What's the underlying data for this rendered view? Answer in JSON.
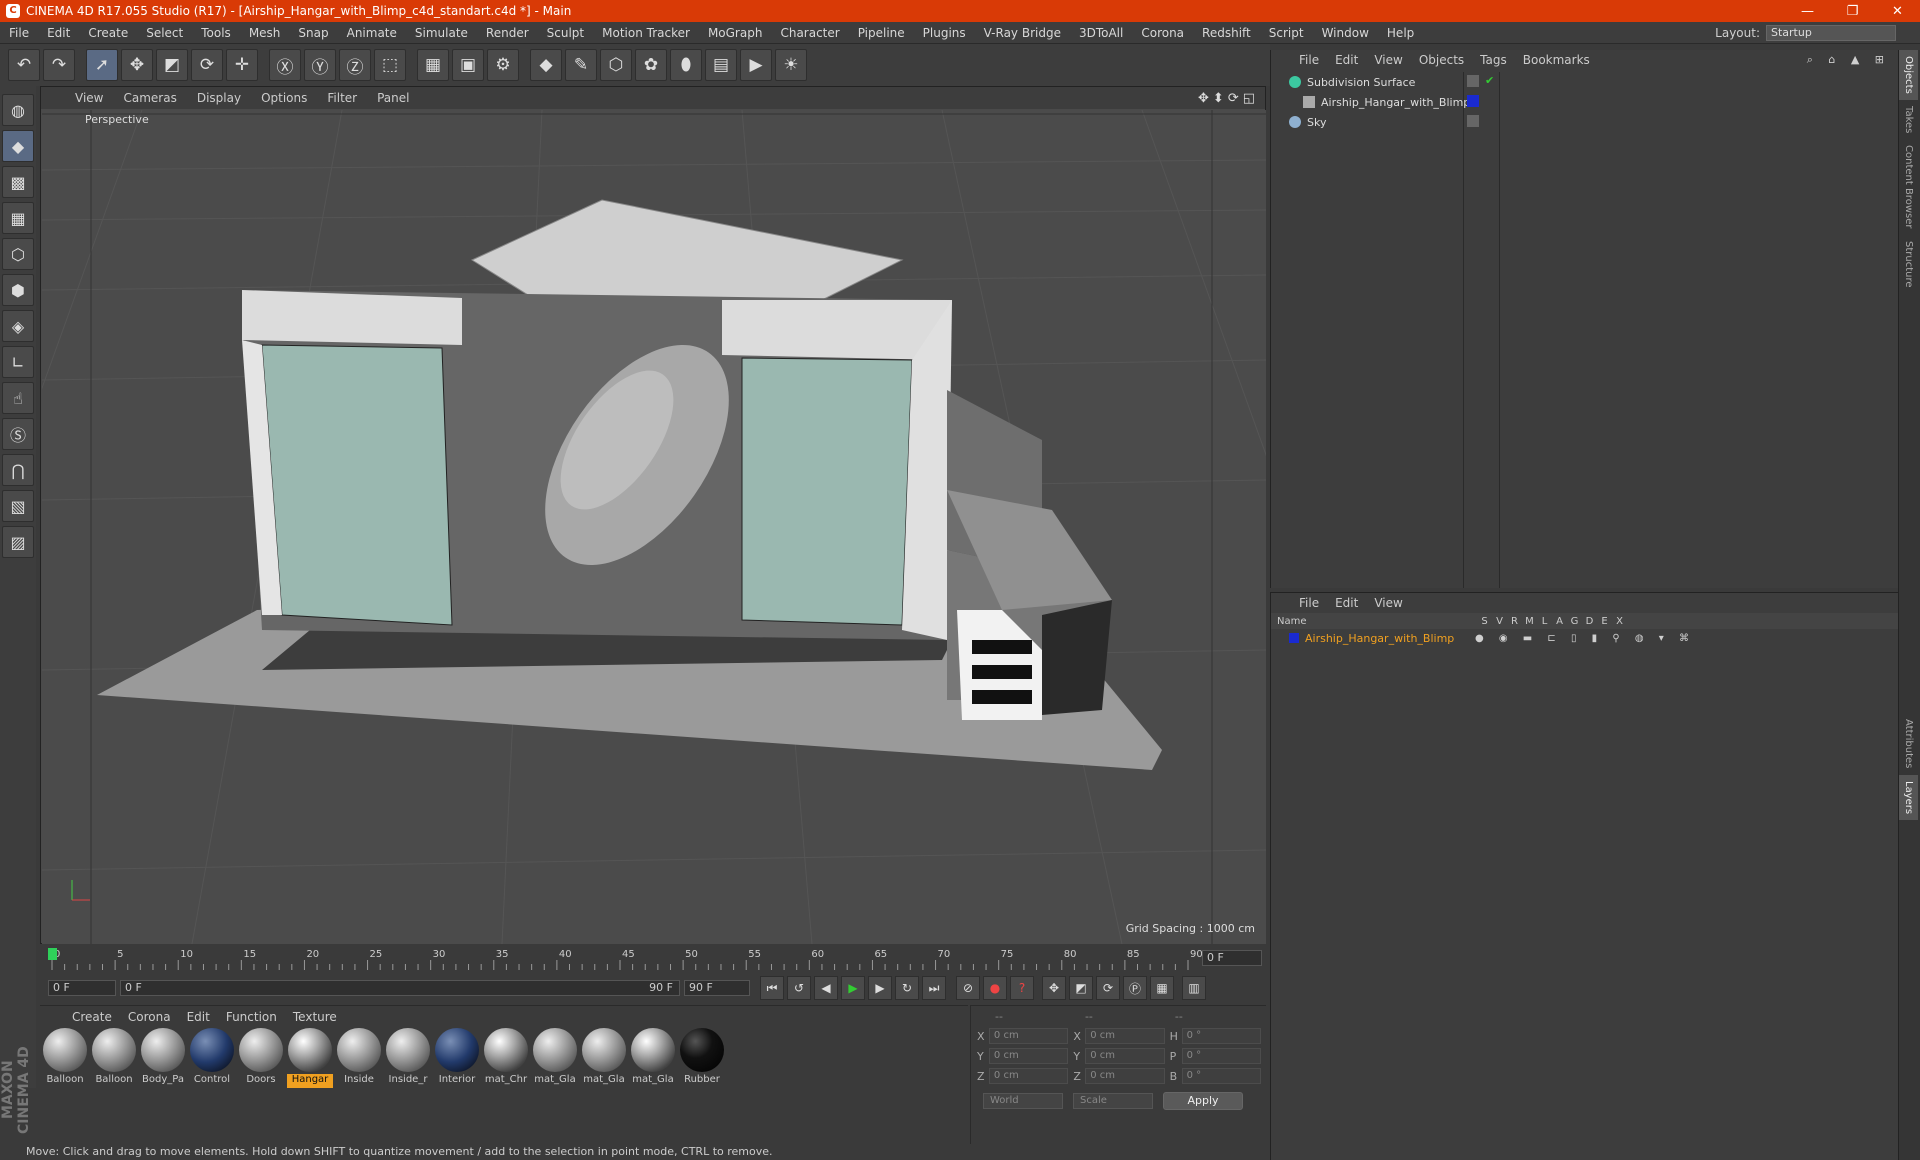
{
  "window": {
    "title": "CINEMA 4D R17.055 Studio (R17) - [Airship_Hangar_with_Blimp_c4d_standart.c4d *] - Main",
    "minimize": "—",
    "restore": "❐",
    "close": "✕"
  },
  "menubar": {
    "items": [
      "File",
      "Edit",
      "Create",
      "Select",
      "Tools",
      "Mesh",
      "Snap",
      "Animate",
      "Simulate",
      "Render",
      "Sculpt",
      "Motion Tracker",
      "MoGraph",
      "Character",
      "Pipeline",
      "Plugins",
      "V-Ray Bridge",
      "3DToAll",
      "Corona",
      "Redshift",
      "Script",
      "Window",
      "Help"
    ],
    "layout_label": "Layout:",
    "layout_value": "Startup"
  },
  "viewport": {
    "menu": [
      "View",
      "Cameras",
      "Display",
      "Options",
      "Filter",
      "Panel"
    ],
    "nav_icons": "✥⬍⟳◱",
    "label": "Perspective",
    "grid_spacing": "Grid Spacing : 1000 cm"
  },
  "timeline": {
    "ticks": [
      "0",
      "5",
      "10",
      "15",
      "20",
      "25",
      "30",
      "35",
      "40",
      "45",
      "50",
      "55",
      "60",
      "65",
      "70",
      "75",
      "80",
      "85",
      "90"
    ],
    "current_frame": "0 F",
    "start_field": "0 F",
    "range_start": "0 F",
    "range_end": "90 F",
    "end_field": "90 F"
  },
  "materials": {
    "menu": [
      "Create",
      "Corona",
      "Edit",
      "Function",
      "Texture"
    ],
    "items": [
      {
        "name": "Balloon",
        "style": "ball"
      },
      {
        "name": "Balloon",
        "style": "ball"
      },
      {
        "name": "Body_Pa",
        "style": "ball"
      },
      {
        "name": "Control",
        "style": "dark"
      },
      {
        "name": "Doors",
        "style": "ball"
      },
      {
        "name": "Hangar",
        "style": "shiny",
        "selected": true
      },
      {
        "name": "Inside",
        "style": "ball"
      },
      {
        "name": "Inside_r",
        "style": "ball"
      },
      {
        "name": "Interior",
        "style": "dark"
      },
      {
        "name": "mat_Chr",
        "style": "shiny"
      },
      {
        "name": "mat_Gla",
        "style": "ball"
      },
      {
        "name": "mat_Gla",
        "style": "ball"
      },
      {
        "name": "mat_Gla",
        "style": "shiny"
      },
      {
        "name": "Rubber",
        "style": "black"
      }
    ]
  },
  "coords": {
    "headers": [
      "--",
      "--",
      "--"
    ],
    "rows": [
      {
        "a": "X",
        "v1": "0 cm",
        "b": "X",
        "v2": "0 cm",
        "c": "H",
        "v3": "0 °"
      },
      {
        "a": "Y",
        "v1": "0 cm",
        "b": "Y",
        "v2": "0 cm",
        "c": "P",
        "v3": "0 °"
      },
      {
        "a": "Z",
        "v1": "0 cm",
        "b": "Z",
        "v2": "0 cm",
        "c": "B",
        "v3": "0 °"
      }
    ],
    "world": "World",
    "scale": "Scale",
    "apply": "Apply"
  },
  "status": "Move: Click and drag to move elements. Hold down SHIFT to quantize movement / add to the selection in point mode, CTRL to remove.",
  "object_manager": {
    "menu": [
      "File",
      "Edit",
      "View",
      "Objects",
      "Tags",
      "Bookmarks"
    ],
    "objects": [
      {
        "name": "Subdivision Surface",
        "color": "#3cc8a0"
      },
      {
        "name": "Airship_Hangar_with_Blimp",
        "color": "#aaaaaa"
      },
      {
        "name": "Sky",
        "color": "#8fb0d0"
      }
    ]
  },
  "layer_manager": {
    "menu": [
      "File",
      "Edit",
      "View"
    ],
    "columns": [
      "Name",
      "S",
      "V",
      "R",
      "M",
      "L",
      "A",
      "G",
      "D",
      "E",
      "X"
    ],
    "layer_name": "Airship_Hangar_with_Blimp"
  },
  "side_tabs": [
    "Objects",
    "Takes",
    "Content Browser",
    "Structure",
    "Attributes",
    "Layers"
  ],
  "maxon": "MAXON CINEMA 4D",
  "colors": {
    "titlebar": "#d93a06",
    "accent": "#f0a020",
    "layer_color": "#1a2ad0"
  }
}
